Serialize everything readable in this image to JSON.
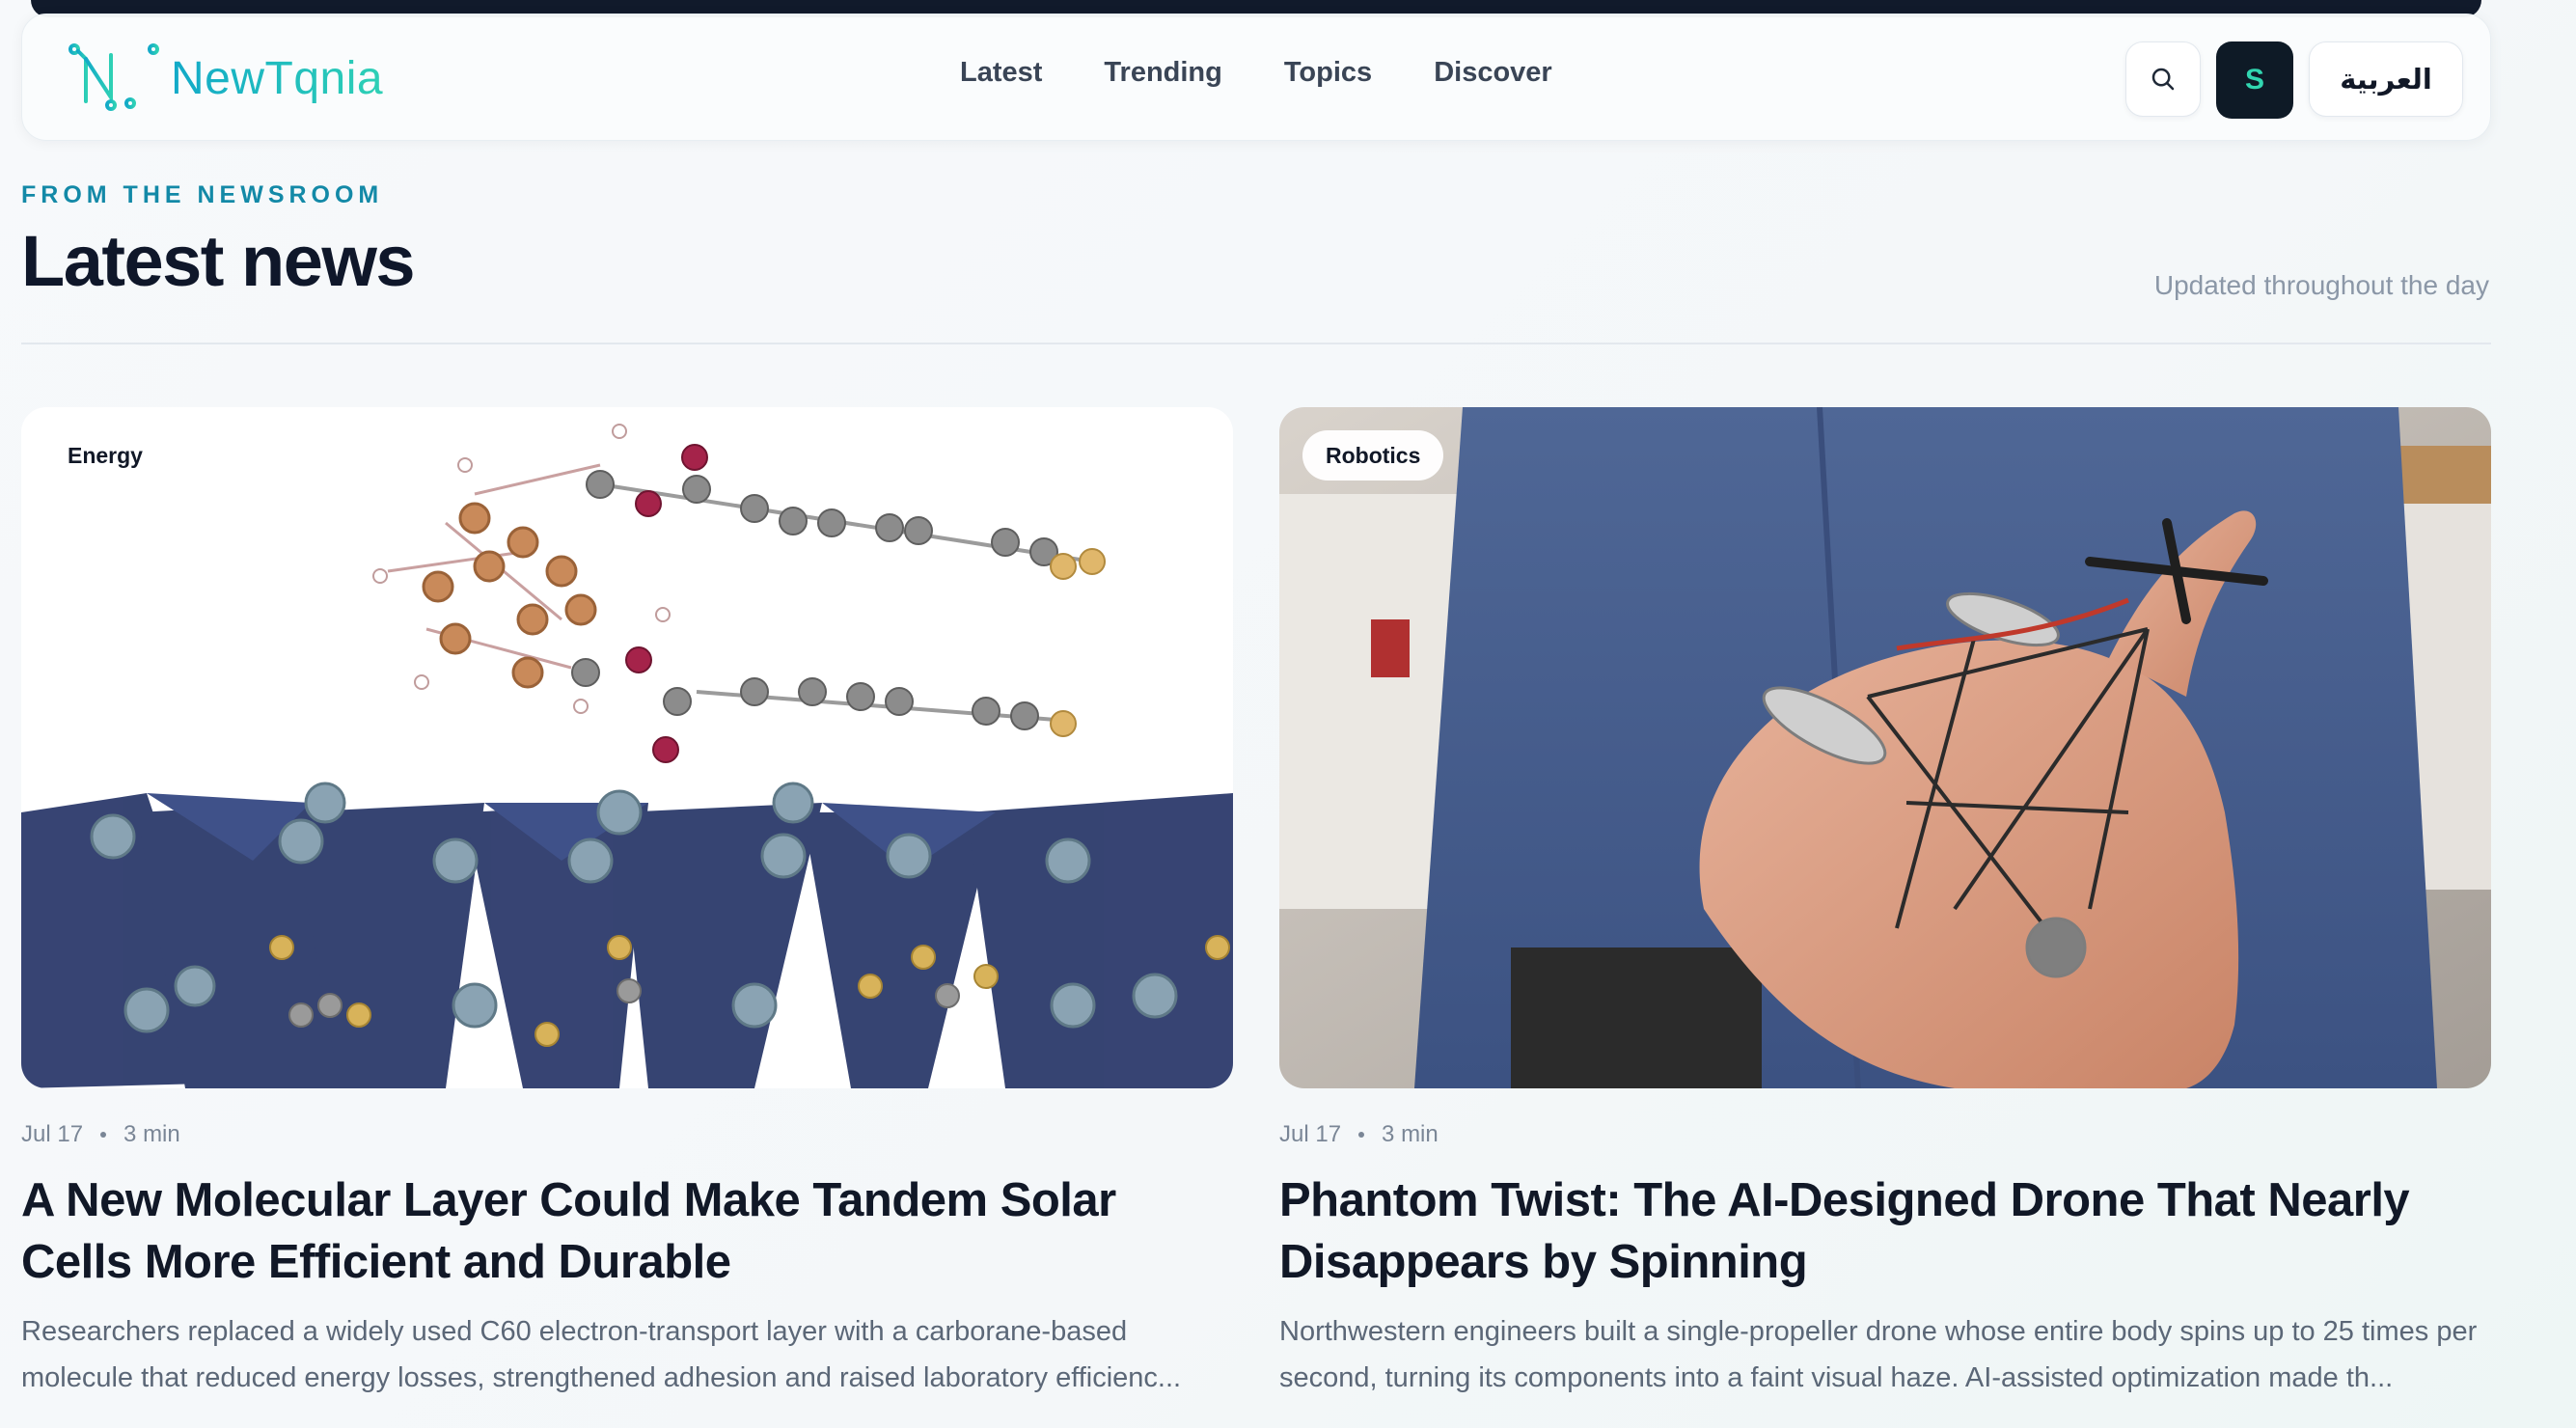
{
  "brand": {
    "name": "NewTqnia"
  },
  "nav": {
    "items": [
      "Latest",
      "Trending",
      "Topics",
      "Discover"
    ]
  },
  "actions": {
    "avatar_initial": "S",
    "language_label": "العربية"
  },
  "section": {
    "eyebrow": "FROM THE NEWSROOM",
    "title": "Latest news",
    "updated": "Updated throughout the day"
  },
  "articles": [
    {
      "tag": "Energy",
      "date": "Jul 17",
      "read_time": "3 min",
      "title": "A New Molecular Layer Could Make Tandem Solar Cells More Efficient and Durable",
      "excerpt": "Researchers replaced a widely used C60 electron-transport layer with a carborane-based molecule that reduced energy losses, strengthened adhesion and raised laboratory efficienc..."
    },
    {
      "tag": "Robotics",
      "date": "Jul 17",
      "read_time": "3 min",
      "title": "Phantom Twist: The AI-Designed Drone That Nearly Disappears by Spinning",
      "excerpt": "Northwestern engineers built a single-propeller drone whose entire body spins up to 25 times per second, turning its components into a faint visual haze. AI-assisted optimization made th..."
    }
  ],
  "colors": {
    "accent": "#1389a7",
    "brand_gradient_start": "#12a9c8",
    "brand_gradient_end": "#2ed0b5",
    "avatar_bg": "#0e1a26",
    "avatar_fg": "#31d6b0"
  },
  "icons": {
    "logo": "circuit-nt-logo-icon",
    "search": "search-icon"
  }
}
